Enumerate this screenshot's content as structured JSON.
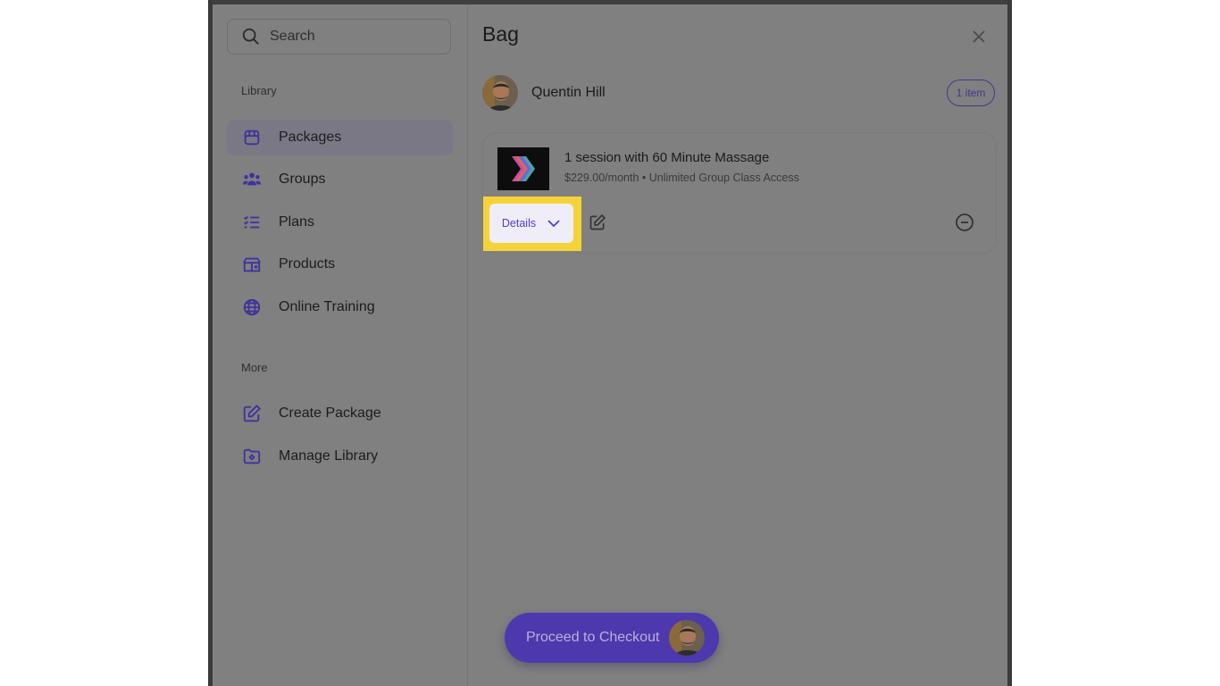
{
  "search": {
    "placeholder": "Search"
  },
  "sidebar": {
    "library_label": "Library",
    "items": [
      {
        "label": "Packages",
        "icon": "package-icon",
        "active": true
      },
      {
        "label": "Groups",
        "icon": "groups-icon"
      },
      {
        "label": "Plans",
        "icon": "plans-icon"
      },
      {
        "label": "Products",
        "icon": "products-icon"
      },
      {
        "label": "Online Training",
        "icon": "globe-icon"
      }
    ],
    "more_label": "More",
    "more_items": [
      {
        "label": "Create Package",
        "icon": "edit-icon"
      },
      {
        "label": "Manage Library",
        "icon": "folder-settings-icon"
      }
    ]
  },
  "bag": {
    "title": "Bag",
    "customer_name": "Quentin Hill",
    "item_count": "1 item",
    "item": {
      "title": "1 session with 60 Minute Massage",
      "subtitle": "$229.00/month • Unlimited Group Class Access",
      "details_label": "Details"
    },
    "checkout_label": "Proceed to Checkout"
  },
  "colors": {
    "accent": "#4a3fd4",
    "checkout_bg": "#4d38ae",
    "highlight": "#f4d33a",
    "overlay": "#808080"
  }
}
